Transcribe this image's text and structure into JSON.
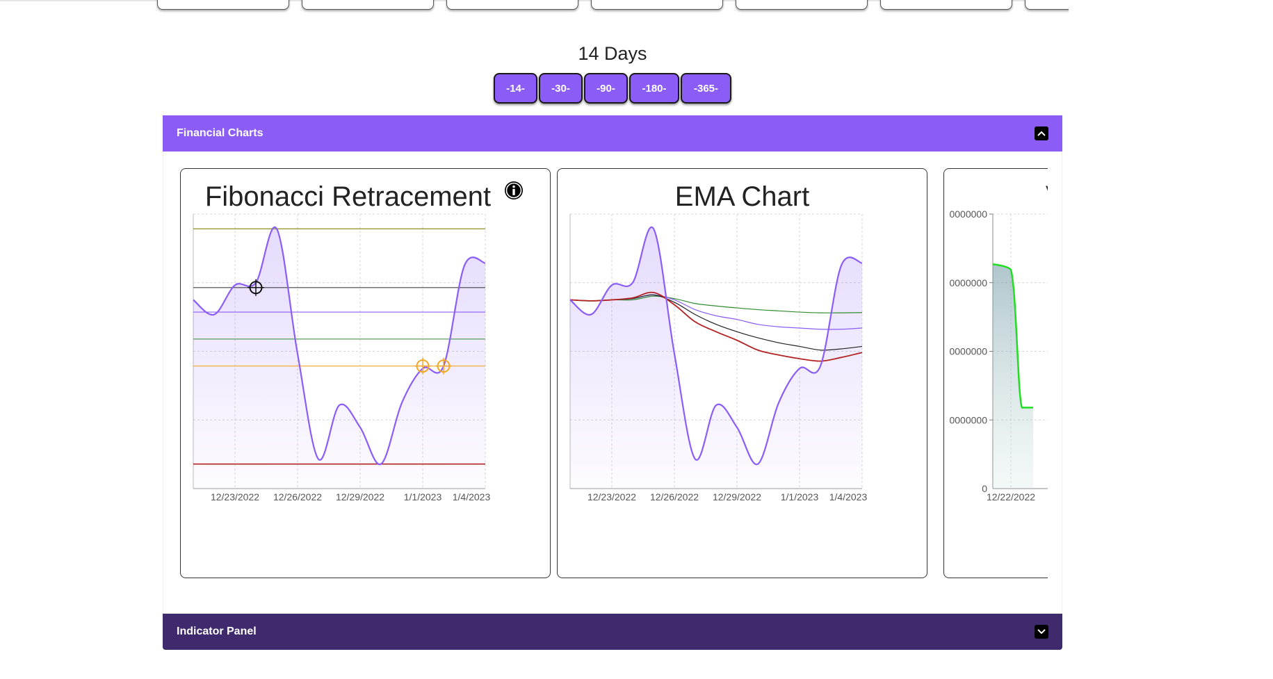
{
  "period": {
    "title": "14 Days"
  },
  "range_buttons": [
    "-14-",
    "-30-",
    "-90-",
    "-180-",
    "-365-"
  ],
  "sections": {
    "financial": {
      "label": "Financial Charts"
    },
    "indicator": {
      "label": "Indicator Panel"
    }
  },
  "colors": {
    "accent": "#8b5cf6",
    "indicator_bar": "#3f2a6e",
    "fib_olive": "#808000",
    "fib_dark": "#404040",
    "fib_purple": "#8b5cf6",
    "fib_green": "#2e8b2e",
    "fib_orange": "#f5a623",
    "fib_red": "#b22222",
    "ema_green": "#2e8b2e",
    "ema_black": "#222222",
    "ema_red": "#b22222",
    "vol_green": "#22dd22"
  },
  "icons": {
    "info": "info-icon",
    "collapse": "chevron-up-icon",
    "expand": "chevron-down-icon",
    "prev": "arrow-left-icon",
    "next": "arrow-right-icon",
    "crosshair": "crosshair-icon"
  },
  "chart_data": [
    {
      "type": "line",
      "title": "Fibonacci Retracement",
      "x": [
        "12/21/2022",
        "12/22/2022",
        "12/23/2022",
        "12/24/2022",
        "12/25/2022",
        "12/26/2022",
        "12/27/2022",
        "12/28/2022",
        "12/29/2022",
        "12/30/2022",
        "12/31/2022",
        "1/1/2023",
        "1/2/2023",
        "1/3/2023",
        "1/4/2023"
      ],
      "xticks": [
        "12/23/2022",
        "12/26/2022",
        "12/29/2022",
        "1/1/2023",
        "1/4/2023"
      ],
      "series": [
        {
          "values": [
            67,
            61,
            73,
            74,
            96,
            45,
            2,
            24,
            15,
            0,
            25,
            39,
            40,
            81,
            82
          ]
        }
      ],
      "levels": [
        {
          "value": 96,
          "color": "#808000"
        },
        {
          "value": 72,
          "color": "#404040"
        },
        {
          "value": 62,
          "color": "#8b5cf6"
        },
        {
          "value": 51,
          "color": "#2e8b2e"
        },
        {
          "value": 40,
          "color": "#f5a623"
        },
        {
          "value": 0,
          "color": "#b22222"
        }
      ],
      "markers": [
        {
          "x": "12/24/2022",
          "value": 72,
          "color": "#111111"
        },
        {
          "x": "1/1/2023",
          "value": 40,
          "color": "#f5a623"
        },
        {
          "x": "1/2/2023",
          "value": 40,
          "color": "#f5a623"
        }
      ],
      "ylim": [
        -10,
        102
      ],
      "grid": true,
      "yticks_visible": false
    },
    {
      "type": "line",
      "title": "EMA Chart",
      "x": [
        "12/21/2022",
        "12/22/2022",
        "12/23/2022",
        "12/24/2022",
        "12/25/2022",
        "12/26/2022",
        "12/27/2022",
        "12/28/2022",
        "12/29/2022",
        "12/30/2022",
        "12/31/2022",
        "1/1/2023",
        "1/2/2023",
        "1/3/2023",
        "1/4/2023"
      ],
      "xticks": [
        "12/23/2022",
        "12/26/2022",
        "12/29/2022",
        "1/1/2023",
        "1/4/2023"
      ],
      "series": [
        {
          "values": [
            67,
            61,
            73,
            74,
            96,
            45,
            2,
            24,
            15,
            0,
            25,
            39,
            40,
            81,
            82
          ],
          "color": "#8b5cf6"
        },
        {
          "values": [
            67,
            66.5,
            67,
            67,
            68.5,
            67.5,
            65.5,
            64.5,
            63.7,
            63,
            62.5,
            62,
            61.7,
            61.7,
            61.8
          ],
          "color": "#2e8b2e"
        },
        {
          "values": [
            67,
            66.6,
            67,
            67.5,
            69,
            67,
            63,
            60.5,
            59,
            57,
            56,
            55.5,
            55,
            55,
            55.5
          ],
          "color": "#8b5cf6"
        },
        {
          "values": [
            67,
            66.6,
            67,
            67.5,
            69,
            66,
            61,
            57,
            54,
            51.5,
            49.5,
            48,
            46.5,
            47,
            48
          ],
          "color": "#222222"
        },
        {
          "values": [
            67,
            66.6,
            67,
            67.8,
            70,
            65,
            58,
            54,
            50.5,
            46.5,
            44.5,
            43,
            42,
            43.5,
            45.5
          ],
          "color": "#b22222"
        }
      ],
      "ylim": [
        -10,
        102
      ],
      "grid": true
    },
    {
      "type": "area",
      "title": "V",
      "x": [
        "12/21/2022",
        "12/22/2022",
        "12/23/2022",
        "12/24/2022"
      ],
      "xticks": [
        "12/22/2022"
      ],
      "yticks": [
        "0000000",
        "0000000",
        "0000000",
        "0000000",
        "0"
      ],
      "series": [
        {
          "values": [
            3.27,
            3.19,
            1.18,
            1.18
          ],
          "color": "#22dd22"
        }
      ],
      "ylim": [
        0,
        4
      ]
    }
  ]
}
